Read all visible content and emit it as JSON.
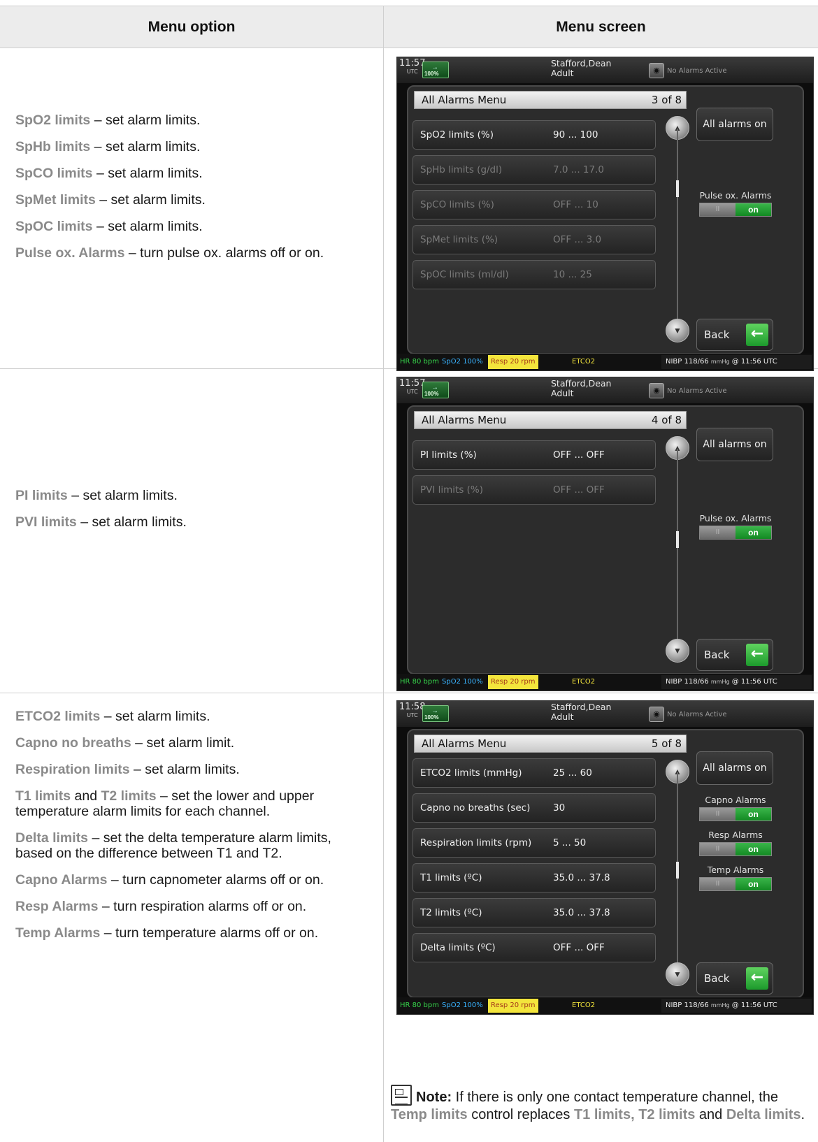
{
  "headers": {
    "left": "Menu option",
    "right": "Menu screen"
  },
  "row1": {
    "options": [
      {
        "term": "SpO2 limits",
        "desc": " – set alarm limits."
      },
      {
        "term": "SpHb limits",
        "desc": " – set alarm limits."
      },
      {
        "term": "SpCO limits",
        "desc": " – set alarm limits."
      },
      {
        "term": "SpMet limits",
        "desc": " – set alarm limits."
      },
      {
        "term": "SpOC limits",
        "desc": " – set alarm limits."
      },
      {
        "term": "Pulse ox. Alarms",
        "desc": " – turn pulse ox. alarms off or on."
      }
    ],
    "screen": {
      "time": "11:57",
      "utc": "UTC",
      "battery": "100%",
      "patient_name": "Stafford,Dean",
      "patient_type": "Adult",
      "alarm_status": "No Alarms Active",
      "menu_title": "All Alarms Menu",
      "page": "3 of 8",
      "limits": [
        {
          "label": "SpO2 limits (%)",
          "value": "90 ... 100"
        },
        {
          "label": "SpHb limits (g/dl)",
          "value": "7.0 ... 17.0"
        },
        {
          "label": "SpCO limits (%)",
          "value": "OFF ... 10"
        },
        {
          "label": "SpMet limits (%)",
          "value": "OFF ... 3.0"
        },
        {
          "label": "SpOC limits (ml/dl)",
          "value": "10 ... 25"
        }
      ],
      "all_alarms": "All alarms on",
      "toggle": {
        "label": "Pulse ox. Alarms",
        "off": "II",
        "on": "on"
      },
      "back": "Back"
    }
  },
  "row2": {
    "options": [
      {
        "term": "PI limits",
        "desc": " – set alarm limits."
      },
      {
        "term": "PVI limits",
        "desc": " – set alarm limits."
      }
    ],
    "screen": {
      "time": "11:57",
      "utc": "UTC",
      "battery": "100%",
      "patient_name": "Stafford,Dean",
      "patient_type": "Adult",
      "alarm_status": "No Alarms Active",
      "menu_title": "All Alarms Menu",
      "page": "4 of 8",
      "limits": [
        {
          "label": "PI limits (%)",
          "value": "OFF ... OFF"
        },
        {
          "label": "PVI limits (%)",
          "value": "OFF ... OFF"
        }
      ],
      "all_alarms": "All alarms on",
      "toggle": {
        "label": "Pulse ox. Alarms",
        "off": "II",
        "on": "on"
      },
      "back": "Back"
    }
  },
  "row3": {
    "options": [
      {
        "term": "ETCO2 limits",
        "desc": " – set alarm limits."
      },
      {
        "term": "Capno no breaths",
        "desc": " – set alarm limit."
      },
      {
        "term": "Respiration limits",
        "desc": " – set alarm limits."
      },
      {
        "term": "T1 limits",
        "mid": " and ",
        "term2": "T2 limits",
        "desc": " – set the lower and upper temperature alarm limits for each channel."
      },
      {
        "term": "Delta limits",
        "desc": " – set the delta temperature alarm limits, based on the difference between T1 and T2."
      },
      {
        "term": "Capno Alarms",
        "desc": " – turn capnometer alarms off or on."
      },
      {
        "term": "Resp Alarms",
        "desc": " – turn respiration alarms off or on."
      },
      {
        "term": "Temp Alarms",
        "desc": " – turn temperature alarms off or on."
      }
    ],
    "screen": {
      "time": "11:58",
      "utc": "UTC",
      "battery": "100%",
      "patient_name": "Stafford,Dean",
      "patient_type": "Adult",
      "alarm_status": "No Alarms Active",
      "menu_title": "All Alarms Menu",
      "page": "5 of 8",
      "limits": [
        {
          "label": "ETCO2 limits (mmHg)",
          "value": "25 ... 60"
        },
        {
          "label": "Capno no breaths (sec)",
          "value": "30"
        },
        {
          "label": "Respiration limits (rpm)",
          "value": "5 ... 50"
        },
        {
          "label": "T1 limits (ºC)",
          "value": "35.0 ... 37.8"
        },
        {
          "label": "T2 limits (ºC)",
          "value": "35.0 ... 37.8"
        },
        {
          "label": "Delta limits (ºC)",
          "value": "OFF ... OFF"
        }
      ],
      "all_alarms": "All alarms on",
      "toggles": [
        {
          "label": "Capno Alarms",
          "off": "II",
          "on": "on"
        },
        {
          "label": "Resp Alarms",
          "off": "II",
          "on": "on"
        },
        {
          "label": "Temp Alarms",
          "off": "II",
          "on": "on"
        }
      ],
      "back": "Back"
    }
  },
  "statusbar": {
    "hr": "HR   80   bpm",
    "spo2": "SpO2 100%",
    "resp": "Resp  20 rpm",
    "etco2": "ETCO2",
    "nibp": "NIBP 118/66",
    "nibp_unit": "mmHg",
    "nibp_time": "@ 11:56 UTC"
  },
  "note": {
    "heading": "Note:",
    "text1": " If there is only one contact temperature channel, the ",
    "term1": "Temp limits",
    "text2": " control replaces ",
    "term2": "T1 limits,",
    "text3": " ",
    "term3": "T2 limits",
    "text4": " and ",
    "term4": "Delta limits",
    "text5": "."
  },
  "colors": {
    "term": "#8a8a8a",
    "green_on": "#1f9c30",
    "resp_bg": "#f3e53c"
  }
}
